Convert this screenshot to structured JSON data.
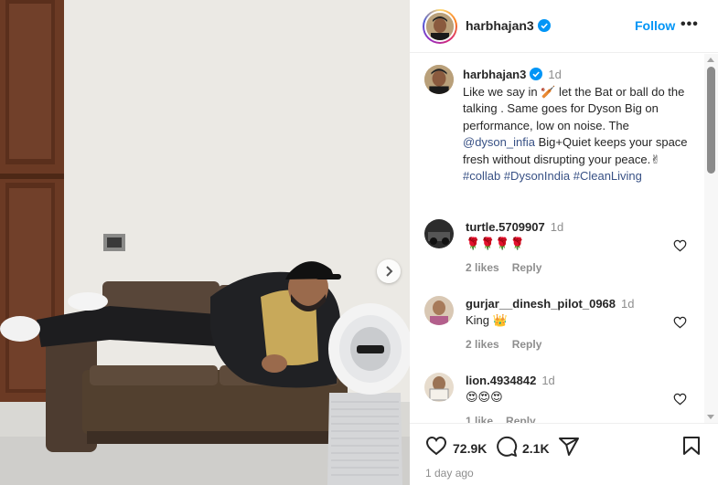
{
  "post": {
    "username": "harbhajan3",
    "follow_label": "Follow",
    "more_label": "•••",
    "caption": {
      "username": "harbhajan3",
      "time": "1d",
      "text_part1": "Like we say in 🏏 let the Bat or ball do the talking . Same goes for Dyson Big on performance, low on noise. The ",
      "mention": "@dyson_infia",
      "text_part2": " Big+Quiet keeps your space fresh without disrupting your peace.✌",
      "hashtags": [
        "#collab",
        "#DysonIndia",
        "#CleanLiving"
      ]
    },
    "comments": [
      {
        "username": "turtle.5709907",
        "time": "1d",
        "text": "🌹🌹🌹🌹",
        "likes": "2 likes",
        "reply": "Reply"
      },
      {
        "username": "gurjar__dinesh_pilot_0968",
        "time": "1d",
        "text": "King 👑",
        "likes": "2 likes",
        "reply": "Reply"
      },
      {
        "username": "lion.4934842",
        "time": "1d",
        "text": "😍😍😍",
        "likes": "1 like",
        "reply": "Reply"
      }
    ],
    "likes_count": "72.9K",
    "comments_count": "2.1K",
    "posted": "1 day ago"
  },
  "colors": {
    "follow_blue": "#0095f6",
    "verified_blue": "#0095f6",
    "link_blue": "#385185",
    "muted_text": "#8e8e8e"
  },
  "icons": [
    "verified-badge-icon",
    "more-options-icon",
    "heart-icon",
    "comment-icon",
    "share-icon",
    "save-icon",
    "chevron-right-icon"
  ]
}
